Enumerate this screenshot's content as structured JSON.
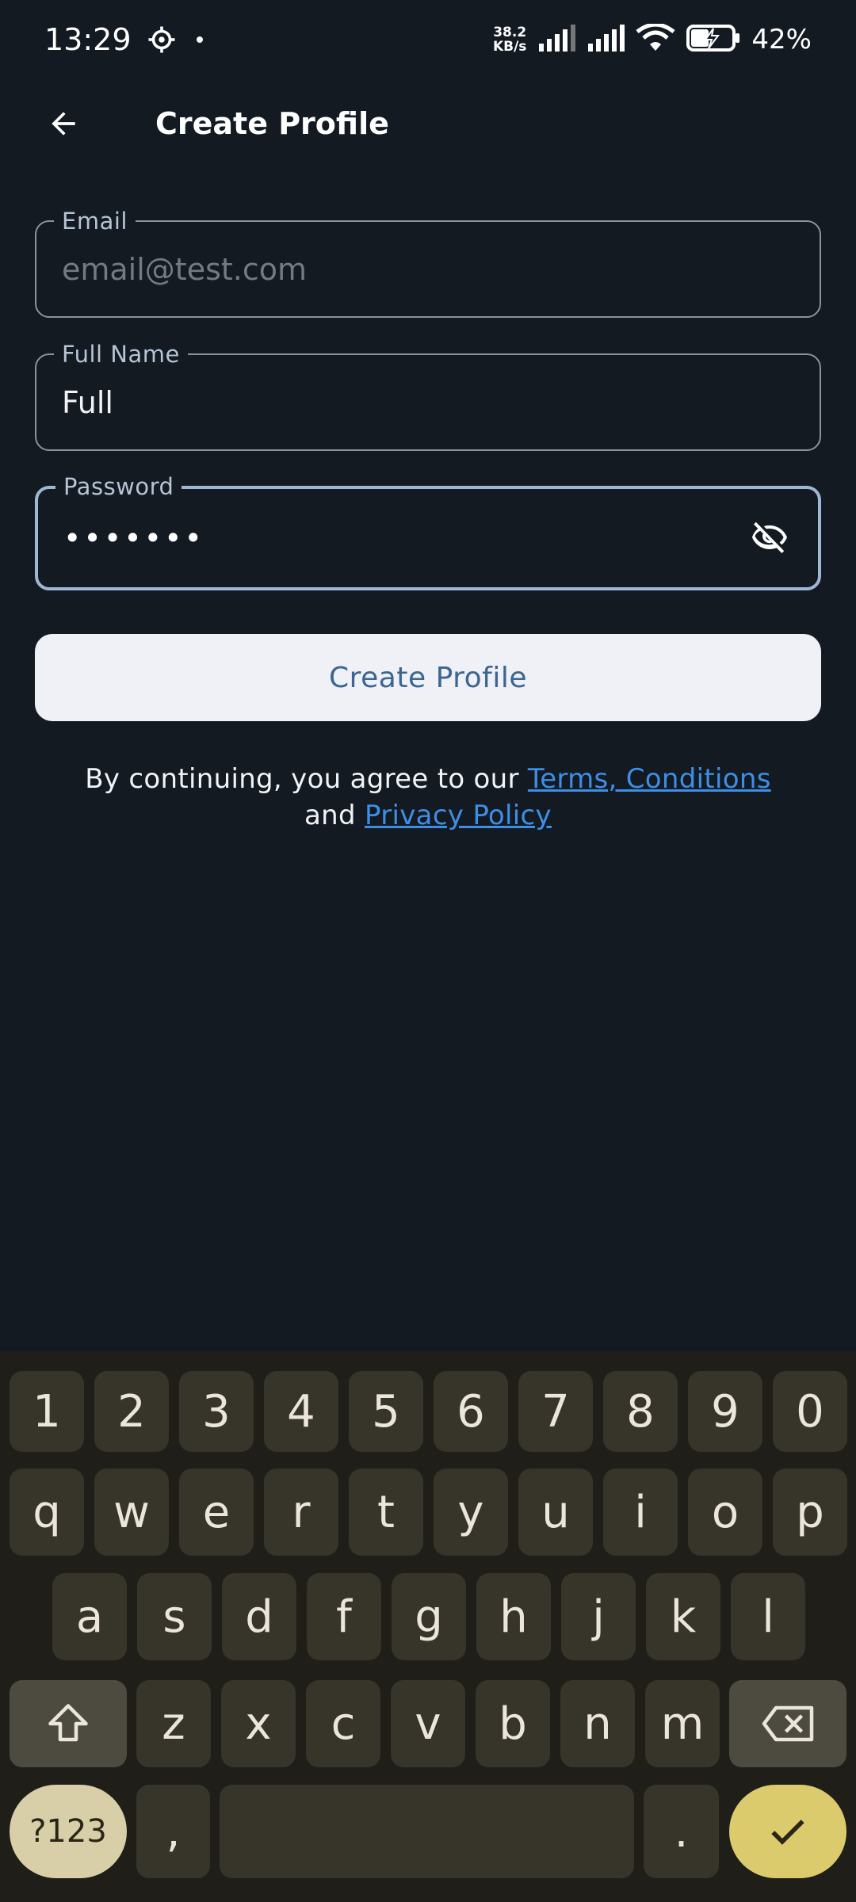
{
  "status_bar": {
    "time": "13:29",
    "net_speed_value": "38.2",
    "net_speed_unit": "KB/s",
    "battery": "42%"
  },
  "app_bar": {
    "title": "Create Profile"
  },
  "form": {
    "email": {
      "label": "Email",
      "placeholder": "email@test.com",
      "value": ""
    },
    "full_name": {
      "label": "Full Name",
      "value": "Full"
    },
    "password": {
      "label": "Password",
      "masked_value": "•••••••"
    }
  },
  "create_button": {
    "label": "Create Profile"
  },
  "terms": {
    "prefix": "By continuing, you agree to our ",
    "terms_link": "Terms, Conditions",
    "middle": "and ",
    "privacy_link": "Privacy Policy"
  },
  "keyboard": {
    "row_numbers": [
      "1",
      "2",
      "3",
      "4",
      "5",
      "6",
      "7",
      "8",
      "9",
      "0"
    ],
    "row1": [
      "q",
      "w",
      "e",
      "r",
      "t",
      "y",
      "u",
      "i",
      "o",
      "p"
    ],
    "row2": [
      "a",
      "s",
      "d",
      "f",
      "g",
      "h",
      "j",
      "k",
      "l"
    ],
    "row3": [
      "z",
      "x",
      "c",
      "v",
      "b",
      "n",
      "m"
    ],
    "symbols_label": "?123",
    "comma": ",",
    "period": "."
  },
  "colors": {
    "background": "#131a21",
    "link": "#3e8ee6",
    "button_bg": "#eff1f7",
    "button_text": "#3c6590",
    "enter_key": "#dccb6c"
  }
}
